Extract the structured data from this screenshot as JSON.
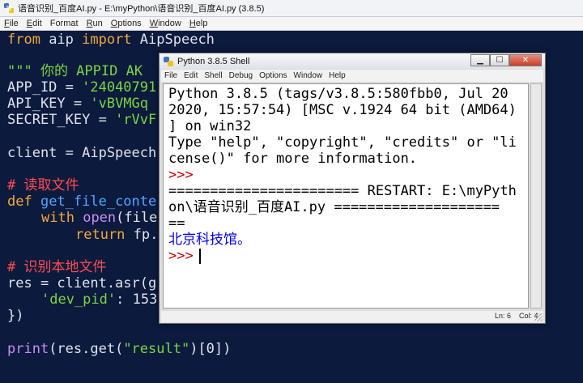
{
  "editor": {
    "title": "语音识别_百度AI.py - E:\\myPython\\语音识别_百度AI.py (3.8.5)",
    "menu": [
      {
        "u": "F",
        "rest": "ile"
      },
      {
        "u": "E",
        "rest": "dit"
      },
      {
        "u": "",
        "rest": "Format"
      },
      {
        "u": "R",
        "rest": "un"
      },
      {
        "u": "O",
        "rest": "ptions"
      },
      {
        "u": "W",
        "rest": "indow"
      },
      {
        "u": "H",
        "rest": "elp"
      }
    ],
    "code": {
      "l1_kw1": "from",
      "l1_mod": " aip ",
      "l1_kw2": "import",
      "l1_name": " AipSpeech",
      "l2": "\"\"\" 你的 APPID AK",
      "l3_name": "APP_ID = ",
      "l3_val": "'24040791",
      "l4_name": "API_KEY = ",
      "l4_val": "'vBVMGq",
      "l5_name": "SECRET_KEY = ",
      "l5_val": "'rVvF",
      "l6": "client = AipSpeech",
      "l7": "# 读取文件",
      "l8_kw": "def",
      "l8_fn": " get_file_conte",
      "l9_kw": "with",
      "l9_bi": "open",
      "l9_rest": "(file",
      "l10_kw": "return",
      "l10_rest": " fp.",
      "l11": "# 识别本地文件",
      "l12": "res = client.asr(g",
      "l13_str": "'dev_pid'",
      "l13_rest": ": 153",
      "l14": "})",
      "l15_bi": "print",
      "l15_a": "(res.get(",
      "l15_str": "\"result\"",
      "l15_b": ")[0])"
    }
  },
  "shell": {
    "title": "Python 3.8.5 Shell",
    "menu": [
      "File",
      "Edit",
      "Shell",
      "Debug",
      "Options",
      "Window",
      "Help"
    ],
    "lines": {
      "l1": "Python 3.8.5 (tags/v3.8.5:580fbb0, Jul 20",
      "l2": "2020, 15:57:54) [MSC v.1924 64 bit (AMD64)",
      "l3": "] on win32",
      "l4": "Type \"help\", \"copyright\", \"credits\" or \"li",
      "l5": "cense()\" for more information.",
      "prompt": ">>>",
      "l7": "======================= RESTART: E:\\myPyth",
      "l8": "on\\语音识别_百度AI.py ====================",
      "l9": "==",
      "result": "北京科技馆。"
    },
    "status": {
      "ln": "Ln: 6",
      "col": "Col: 4"
    },
    "controls": {
      "min": "▁",
      "max": "☐",
      "close": "✕"
    }
  },
  "colors": {
    "editor_bg": "#0b1a3d",
    "keyword": "#f2a93b",
    "string": "#7bd641",
    "comment": "#ff4d4d",
    "builtin": "#c98ef6",
    "function": "#4ea6ff",
    "shell_prompt": "#c00000",
    "shell_output": "#0000ff"
  }
}
